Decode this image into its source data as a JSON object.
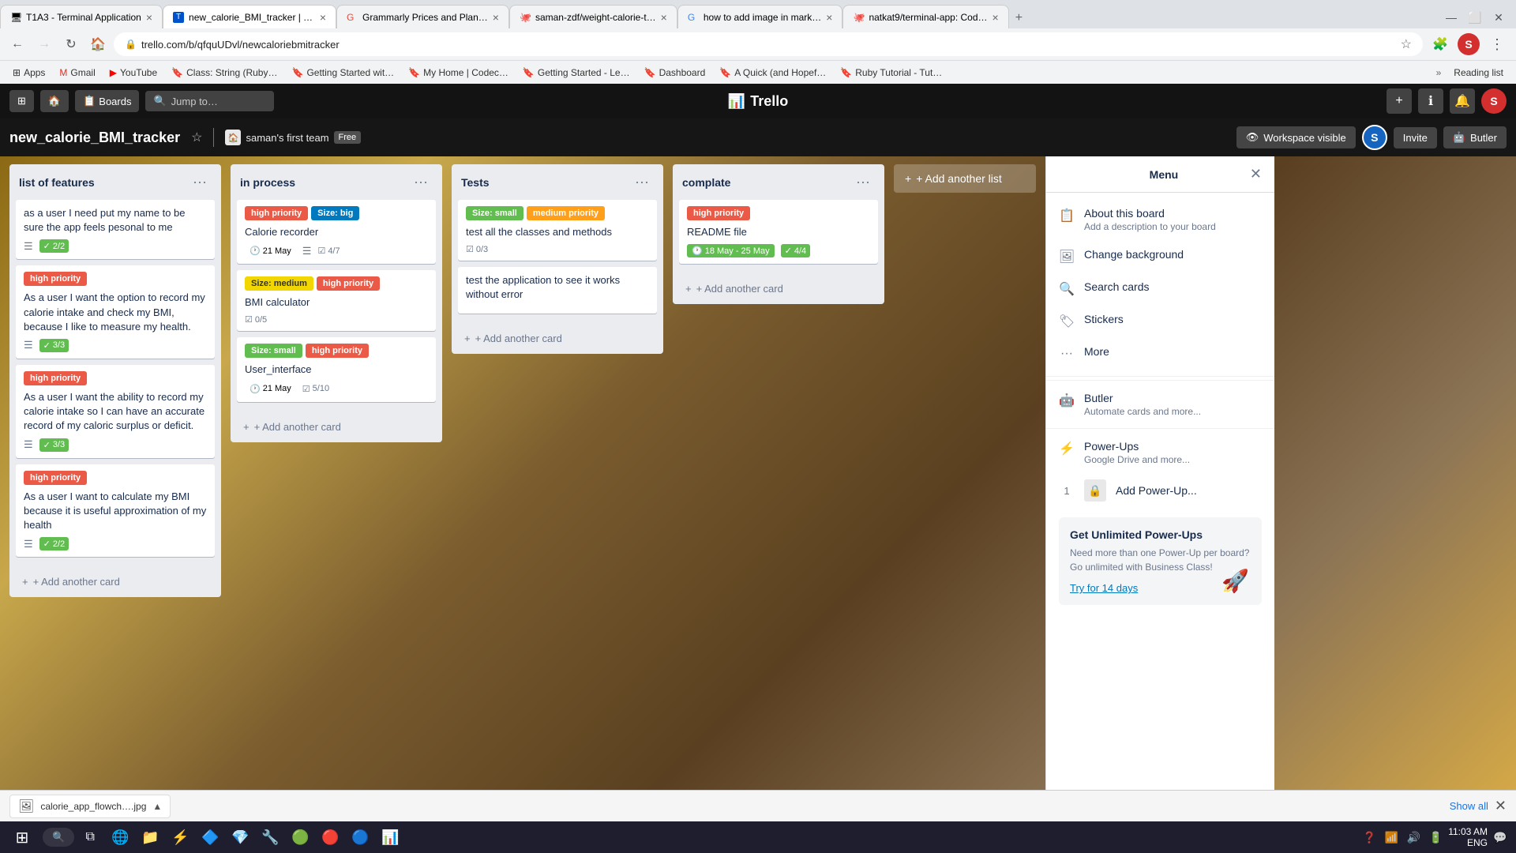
{
  "browser": {
    "tabs": [
      {
        "id": "tab1",
        "title": "T1A3 - Terminal Application",
        "favicon": "🖥",
        "active": false
      },
      {
        "id": "tab2",
        "title": "new_calorie_BMI_tracker | T…",
        "favicon": "📋",
        "active": true
      },
      {
        "id": "tab3",
        "title": "Grammarly Prices and Plan…",
        "favicon": "📝",
        "active": false
      },
      {
        "id": "tab4",
        "title": "saman-zdf/weight-calorie-t…",
        "favicon": "🐙",
        "active": false
      },
      {
        "id": "tab5",
        "title": "how to add image in mark…",
        "favicon": "🔍",
        "active": false
      },
      {
        "id": "tab6",
        "title": "natkat9/terminal-app: Cod…",
        "favicon": "🐙",
        "active": false
      }
    ],
    "address": "trello.com/b/qfquUDvl/newcaloriebmitracker",
    "bookmarks": [
      {
        "label": "Apps",
        "icon": "⊞"
      },
      {
        "label": "Gmail",
        "icon": "✉"
      },
      {
        "label": "YouTube",
        "icon": "▶"
      },
      {
        "label": "Class: String (Ruby…",
        "icon": "🔖"
      },
      {
        "label": "Getting Started wit…",
        "icon": "🔖"
      },
      {
        "label": "My Home | Codec…",
        "icon": "🔖"
      },
      {
        "label": "Getting Started - Le…",
        "icon": "🔖"
      },
      {
        "label": "Dashboard",
        "icon": "🔖"
      },
      {
        "label": "A Quick (and Hopef…",
        "icon": "🔖"
      },
      {
        "label": "Ruby Tutorial - Tut…",
        "icon": "🔖"
      }
    ],
    "reading_list": "Reading list"
  },
  "trello": {
    "header": {
      "home_icon": "⊞",
      "boards_label": "Boards",
      "jump_placeholder": "Jump to…",
      "logo": "Trello",
      "create_label": "+",
      "info_label": "ℹ",
      "notif_label": "🔔",
      "avatar_letter": "S"
    },
    "subheader": {
      "board_name": "new_calorie_BMI_tracker",
      "team_name": "saman's first team",
      "free_label": "Free",
      "workspace_label": "Workspace visible",
      "invite_label": "Invite",
      "butler_label": "Butler",
      "avatar_letter": "S"
    },
    "lists": [
      {
        "id": "list1",
        "title": "list of features",
        "cards": [
          {
            "id": "c1",
            "text": "as a user I need put my name to be sure the app feels pesonal to me",
            "labels": [],
            "badges": {
              "checklist": "2/2"
            },
            "checklist_green": true
          },
          {
            "id": "c2",
            "text": "As a user I want the option to record my calorie intake and check my BMI, because I like to measure my health.",
            "labels": [
              {
                "type": "red",
                "text": "high priority"
              }
            ],
            "badges": {
              "checklist": "3/3"
            },
            "checklist_green": true
          },
          {
            "id": "c3",
            "text": "As a user I want the ability to record my calorie intake so I can have an accurate record of my caloric surplus or deficit.",
            "labels": [
              {
                "type": "red",
                "text": "high priority"
              }
            ],
            "badges": {
              "checklist": "3/3"
            },
            "checklist_green": true
          },
          {
            "id": "c4",
            "text": "As a user I want to calculate my BMI because it is useful approximation of my health",
            "labels": [
              {
                "type": "red",
                "text": "high priority"
              }
            ],
            "badges": {
              "checklist": "2/2"
            },
            "checklist_green": true
          }
        ],
        "add_label": "+ Add another card"
      },
      {
        "id": "list2",
        "title": "in process",
        "cards": [
          {
            "id": "c5",
            "text": "Calorie recorder",
            "labels": [
              {
                "type": "red",
                "text": "high priority"
              },
              {
                "type": "blue",
                "text": "Size: big"
              }
            ],
            "badges": {
              "date": "21 May",
              "checklist": "4/7"
            },
            "checklist_green": false
          },
          {
            "id": "c6",
            "text": "BMI calculator",
            "labels": [
              {
                "type": "yellow",
                "text": "Size: medium"
              },
              {
                "type": "red",
                "text": "high priority"
              }
            ],
            "badges": {
              "checklist": "0/5"
            },
            "checklist_green": false
          },
          {
            "id": "c7",
            "text": "User_interface",
            "labels": [
              {
                "type": "green",
                "text": "Size: small"
              },
              {
                "type": "red",
                "text": "high priority"
              }
            ],
            "badges": {
              "date": "21 May",
              "checklist": "5/10"
            },
            "checklist_green": false
          }
        ],
        "add_label": "+ Add another card"
      },
      {
        "id": "list3",
        "title": "Tests",
        "cards": [
          {
            "id": "c8",
            "text": "test all the classes and methods",
            "labels": [
              {
                "type": "green",
                "text": "Size: small"
              },
              {
                "type": "orange",
                "text": "medium priority"
              }
            ],
            "badges": {
              "checklist": "0/3"
            },
            "checklist_green": false
          },
          {
            "id": "c9",
            "text": "test the application to see it works without error",
            "labels": [],
            "badges": {},
            "checklist_green": false
          }
        ],
        "add_label": "+ Add another card"
      },
      {
        "id": "list4",
        "title": "complate",
        "cards": [
          {
            "id": "c10",
            "text": "README file",
            "labels": [
              {
                "type": "red",
                "text": "high priority"
              }
            ],
            "badges": {
              "date_range": "18 May - 25 May",
              "checklist": "4/4"
            },
            "checklist_green": true
          }
        ],
        "add_label": "+ Add another card"
      }
    ],
    "add_list_label": "+ Add another list",
    "menu": {
      "title": "Menu",
      "items": [
        {
          "icon": "📋",
          "title": "About this board",
          "subtitle": "Add a description to your board"
        },
        {
          "icon": "🖼",
          "title": "Change background",
          "subtitle": ""
        },
        {
          "icon": "🔍",
          "title": "Search cards",
          "subtitle": ""
        },
        {
          "icon": "🏷",
          "title": "Stickers",
          "subtitle": ""
        },
        {
          "icon": "…",
          "title": "More",
          "subtitle": ""
        }
      ],
      "butler_title": "Butler",
      "butler_subtitle": "Automate cards and more...",
      "power_ups_title": "Power-Ups",
      "power_ups_subtitle": "Google Drive and more...",
      "add_power_up": "Add Power-Up...",
      "upsell": {
        "title": "Get Unlimited Power-Ups",
        "text": "Need more than one Power-Up per board? Go unlimited with Business Class!",
        "link": "Try for 14 days"
      }
    }
  },
  "download_bar": {
    "filename": "calorie_app_flowch….jpg",
    "show_all": "Show all"
  },
  "taskbar": {
    "time": "11:03 AM",
    "lang": "ENG"
  }
}
